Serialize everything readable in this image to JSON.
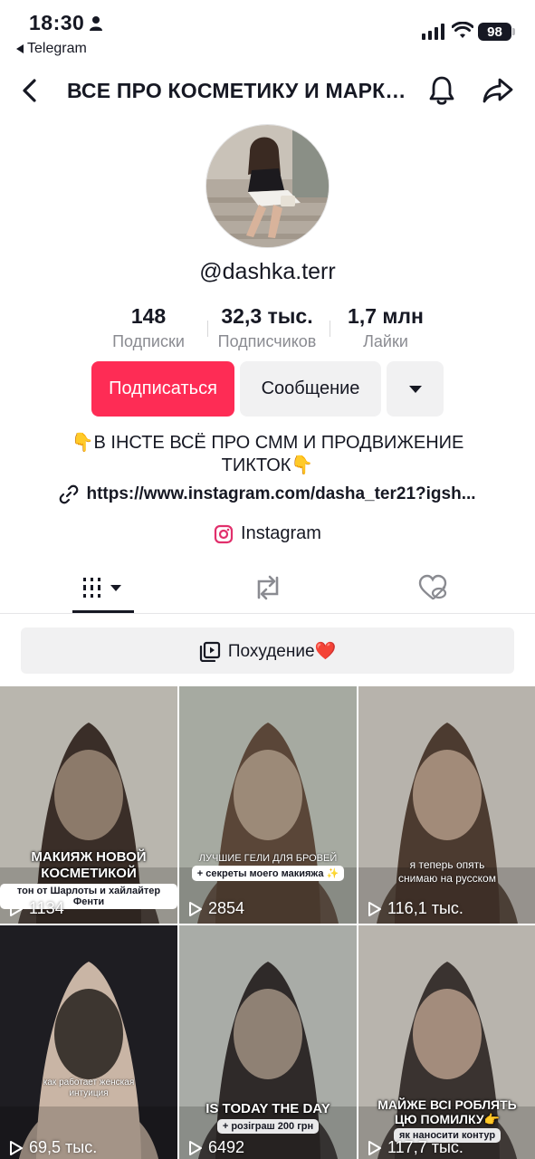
{
  "status_bar": {
    "time": "18:30",
    "back_app": "Telegram",
    "battery": "98"
  },
  "header": {
    "title": "ВСЕ ПРО КОСМЕТИКУ И МАРКЕТИНГ"
  },
  "profile": {
    "username": "@dashka.terr",
    "stats": [
      {
        "value": "148",
        "label": "Подписки"
      },
      {
        "value": "32,3 тыс.",
        "label": "Подписчиков"
      },
      {
        "value": "1,7 млн",
        "label": "Лайки"
      }
    ],
    "subscribe_label": "Подписаться",
    "message_label": "Сообщение",
    "bio": "👇В ІНСТЕ ВСЁ ПРО СММ И ПРОДВИЖЕНИЕ ТИКТОК👇",
    "link": "https://www.instagram.com/dasha_ter21?igsh...",
    "instagram_label": "Instagram"
  },
  "playlist": {
    "label": "Похудение❤️"
  },
  "videos": [
    {
      "caption": "МАКИЯЖ НОВОЙ КОСМЕТИКОЙ",
      "subcaption": "тон от Шарлоты и хайлайтер Фенти",
      "views": "1134",
      "colors": [
        "#b9b6ae",
        "#8c7a6a",
        "#3a2e28"
      ]
    },
    {
      "caption": "ЛУЧШИЕ ГЕЛИ ДЛЯ БРОВЕЙ",
      "subcaption": "+ секреты моего макияжа ✨",
      "views": "2854",
      "colors": [
        "#a6aaa1",
        "#9c8a78",
        "#5a4638"
      ]
    },
    {
      "caption": "я теперь опять снимаю на русском",
      "subcaption": "",
      "views": "116,1 тыс.",
      "colors": [
        "#b7b3ac",
        "#a28b79",
        "#4c3b30"
      ]
    },
    {
      "caption": "как работает женская интуиция",
      "subcaption": "",
      "views": "69,5 тыс.",
      "colors": [
        "#1e1d22",
        "#3d3630",
        "#c9b5a5"
      ]
    },
    {
      "caption": "IS TODAY THE DAY",
      "subcaption": "+ розіграш 200 грн",
      "views": "6492",
      "colors": [
        "#a9aca7",
        "#8f8174",
        "#2f2a29"
      ]
    },
    {
      "caption": "МАЙЖЕ ВСІ РОБЛЯТЬ ЦЮ ПОМИЛКУ👉",
      "subcaption": "як наносити контур",
      "views": "117,7 тыс.",
      "colors": [
        "#b8b4ad",
        "#a38c7c",
        "#3a3330"
      ]
    }
  ],
  "colors": {
    "accent": "#fe2c55",
    "button_gray": "#f1f1f2",
    "muted_text": "#8a8b91"
  }
}
